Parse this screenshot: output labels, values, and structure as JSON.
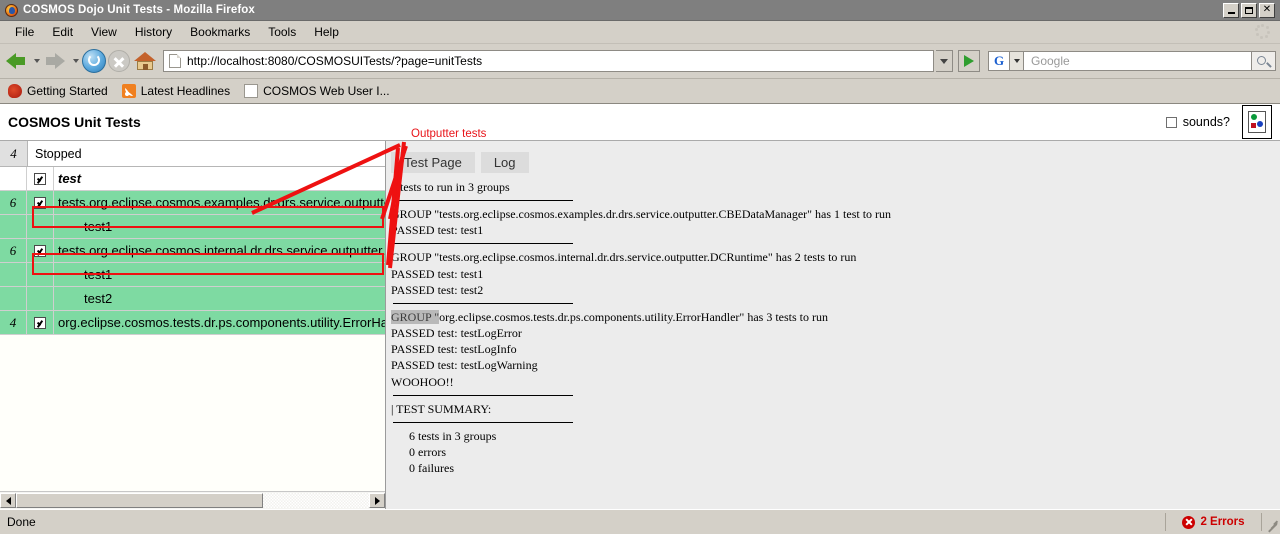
{
  "window": {
    "title": "COSMOS Dojo Unit Tests - Mozilla Firefox",
    "minimize_label": "_",
    "maximize_label": "",
    "close_label": "✕"
  },
  "menubar": {
    "items": [
      {
        "label": "File"
      },
      {
        "label": "Edit"
      },
      {
        "label": "View"
      },
      {
        "label": "History"
      },
      {
        "label": "Bookmarks"
      },
      {
        "label": "Tools"
      },
      {
        "label": "Help"
      }
    ]
  },
  "toolbar": {
    "url": "http://localhost:8080/COSMOSUITests/?page=unitTests",
    "search_placeholder": "Google",
    "search_value": "",
    "search_engine": "G"
  },
  "bookmarks": {
    "items": [
      {
        "label": "Getting Started",
        "icon": "dino-icon"
      },
      {
        "label": "Latest Headlines",
        "icon": "rss-icon"
      },
      {
        "label": "COSMOS Web User I...",
        "icon": "document-icon"
      }
    ]
  },
  "page": {
    "title": "COSMOS Unit Tests",
    "sounds_label": "sounds?",
    "sounds_checked": false,
    "broken_image_alt": ""
  },
  "runner": {
    "status_count": "4",
    "status_label": "Stopped",
    "rows": [
      {
        "count": "",
        "checked": true,
        "label": "test",
        "style": "white",
        "indent": false,
        "boxed": false,
        "bold_italic": true
      },
      {
        "count": "6",
        "checked": true,
        "label": "tests.org.eclipse.cosmos.examples.dr.drs.service.outputter.",
        "style": "green",
        "indent": false,
        "boxed": true,
        "bold_italic": false
      },
      {
        "count": "",
        "checked": false,
        "label": "test1",
        "style": "green",
        "indent": true,
        "boxed": false,
        "bold_italic": false
      },
      {
        "count": "6",
        "checked": true,
        "label": "tests.org.eclipse.cosmos.internal.dr.drs.service.outputter.DC",
        "style": "green",
        "indent": false,
        "boxed": true,
        "bold_italic": false
      },
      {
        "count": "",
        "checked": false,
        "label": "test1",
        "style": "green",
        "indent": true,
        "boxed": false,
        "bold_italic": false
      },
      {
        "count": "",
        "checked": false,
        "label": "test2",
        "style": "green",
        "indent": true,
        "boxed": false,
        "bold_italic": false
      },
      {
        "count": "4",
        "checked": true,
        "label": "org.eclipse.cosmos.tests.dr.ps.components.utility.ErrorHand",
        "style": "green",
        "indent": false,
        "boxed": false,
        "bold_italic": false
      }
    ]
  },
  "results": {
    "tabs": [
      {
        "label": "Test Page",
        "active": true
      },
      {
        "label": "Log",
        "active": false
      }
    ],
    "lines": [
      {
        "type": "text",
        "text": "6 tests to run in 3 groups"
      },
      {
        "type": "rule"
      },
      {
        "type": "text",
        "text": "GROUP \"tests.org.eclipse.cosmos.examples.dr.drs.service.outputter.CBEDataManager\" has 1 test to run"
      },
      {
        "type": "text",
        "text": "PASSED test: test1"
      },
      {
        "type": "rule"
      },
      {
        "type": "text",
        "text": "GROUP \"tests.org.eclipse.cosmos.internal.dr.drs.service.outputter.DCRuntime\" has 2 tests to run"
      },
      {
        "type": "text",
        "text": "PASSED test: test1"
      },
      {
        "type": "text",
        "text": "PASSED test: test2"
      },
      {
        "type": "rule"
      },
      {
        "type": "selected",
        "selected_text": "GROUP \"",
        "text": "org.eclipse.cosmos.tests.dr.ps.components.utility.ErrorHandler\" has 3 tests to run"
      },
      {
        "type": "text",
        "text": "PASSED test: testLogError"
      },
      {
        "type": "text",
        "text": "PASSED test: testLogInfo"
      },
      {
        "type": "text",
        "text": "PASSED test: testLogWarning"
      },
      {
        "type": "text",
        "text": "WOOHOO!!"
      },
      {
        "type": "rule"
      },
      {
        "type": "text",
        "text": "| TEST SUMMARY:"
      },
      {
        "type": "rule"
      },
      {
        "type": "indent",
        "text": "6 tests in 3 groups"
      },
      {
        "type": "indent",
        "text": "0 errors"
      },
      {
        "type": "indent",
        "text": "0 failures"
      }
    ]
  },
  "annotation": {
    "label": "Outputter tests",
    "color": "#e8151a"
  },
  "statusbar": {
    "message": "Done",
    "errors_label": "2 Errors"
  }
}
